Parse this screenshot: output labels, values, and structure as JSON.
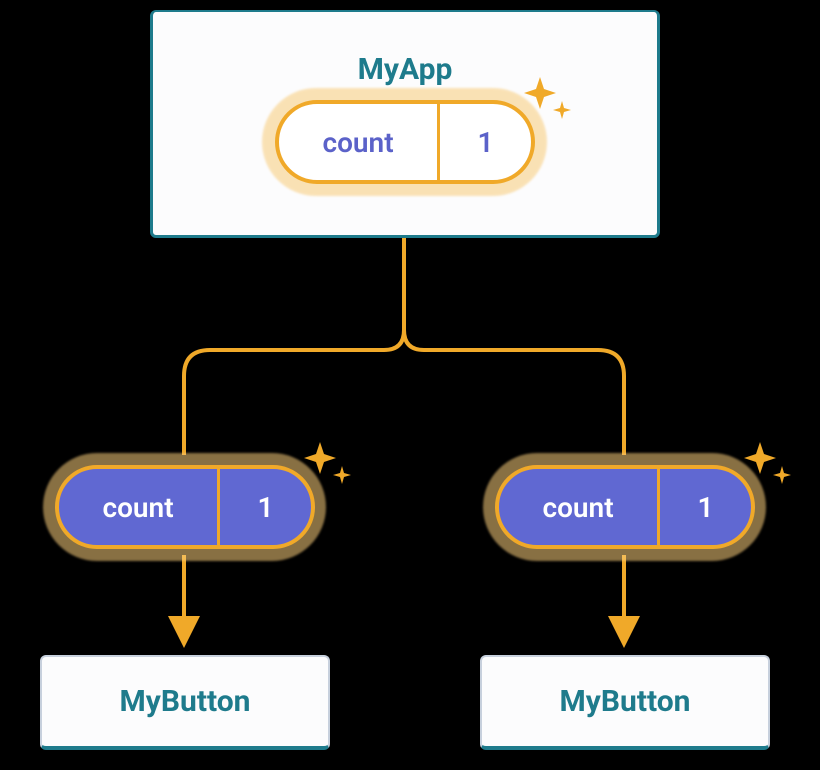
{
  "parent": {
    "title": "MyApp",
    "pill_label": "count",
    "pill_value": "1"
  },
  "children": [
    {
      "pill_label": "count",
      "pill_value": "1",
      "title": "MyButton"
    },
    {
      "pill_label": "count",
      "pill_value": "1",
      "title": "MyButton"
    }
  ],
  "colors": {
    "accent_teal": "#1e7b8c",
    "accent_orange": "#f0a929",
    "accent_purple": "#6068d2"
  }
}
